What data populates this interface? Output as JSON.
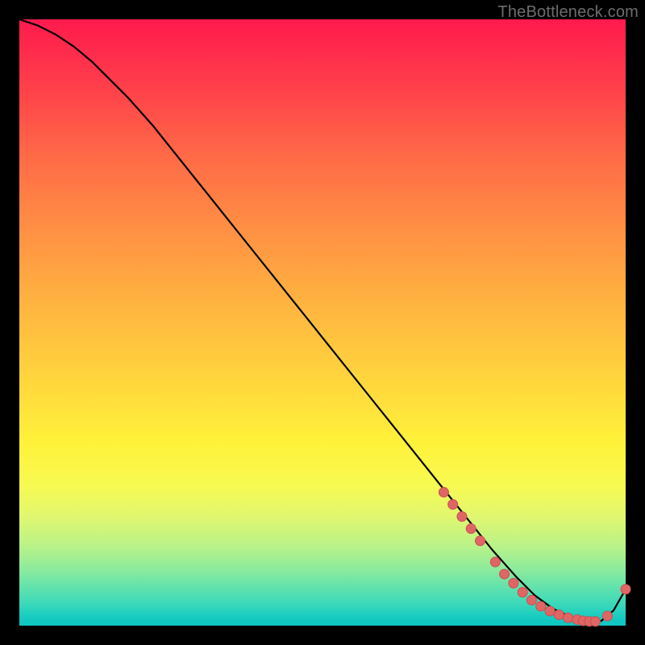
{
  "attribution": "TheBottleneck.com",
  "colors": {
    "curve": "#000000",
    "dot_fill": "#e06666",
    "dot_stroke": "#c94f4f",
    "background": "#000000"
  },
  "chart_data": {
    "type": "line",
    "title": "",
    "xlabel": "",
    "ylabel": "",
    "xlim": [
      0,
      100
    ],
    "ylim": [
      0,
      100
    ],
    "grid": false,
    "series": [
      {
        "name": "bottleneck-curve",
        "x": [
          0,
          3,
          6,
          9,
          12,
          15,
          18,
          22,
          26,
          30,
          34,
          38,
          42,
          46,
          50,
          54,
          58,
          62,
          66,
          70,
          74,
          78,
          82,
          85,
          88,
          91,
          94,
          96,
          98,
          100
        ],
        "y": [
          100,
          99,
          97.5,
          95.5,
          93,
          90,
          87,
          82.5,
          77.5,
          72.5,
          67.5,
          62.5,
          57.5,
          52.5,
          47.5,
          42.5,
          37.5,
          32.5,
          27.5,
          22.5,
          17.5,
          12.5,
          8,
          5,
          2.8,
          1.4,
          0.6,
          0.8,
          2.5,
          6
        ]
      }
    ],
    "scatter": [
      {
        "name": "highlight-dots",
        "x": [
          70,
          71.5,
          73,
          74.5,
          76,
          78.5,
          80,
          81.5,
          83,
          84.5,
          86,
          87.5,
          89,
          90.5,
          92,
          93,
          94,
          95,
          97,
          100
        ],
        "y": [
          22,
          20,
          18,
          16,
          14,
          10.5,
          8.5,
          7,
          5.5,
          4.2,
          3.2,
          2.4,
          1.8,
          1.3,
          1,
          0.8,
          0.7,
          0.7,
          1.6,
          6
        ]
      }
    ]
  }
}
